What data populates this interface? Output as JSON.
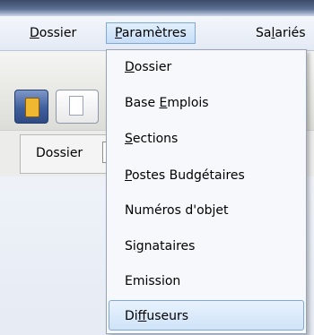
{
  "menubar": {
    "items": [
      {
        "pre": "",
        "ul": "D",
        "post": "ossier"
      },
      {
        "pre": "",
        "ul": "P",
        "post": "aramètres"
      },
      {
        "pre": "Sa",
        "ul": "l",
        "post": "ariés"
      }
    ]
  },
  "toolbar": {
    "field_label": "Dossier",
    "field_value": ""
  },
  "dropdown": {
    "items": [
      {
        "pre": "",
        "ul": "D",
        "post": "ossier"
      },
      {
        "pre": "Base ",
        "ul": "E",
        "post": "mplois"
      },
      {
        "pre": "",
        "ul": "S",
        "post": "ections"
      },
      {
        "pre": "",
        "ul": "P",
        "post": "ostes Budgétaires"
      },
      {
        "pre": "Numéros d'objet",
        "ul": "",
        "post": ""
      },
      {
        "pre": "Si",
        "ul": "g",
        "post": "nataires"
      },
      {
        "pre": "Emission",
        "ul": "",
        "post": ""
      },
      {
        "pre": "Di",
        "ul": "ff",
        "post": "useurs"
      }
    ],
    "highlighted": "Diffuseurs"
  }
}
